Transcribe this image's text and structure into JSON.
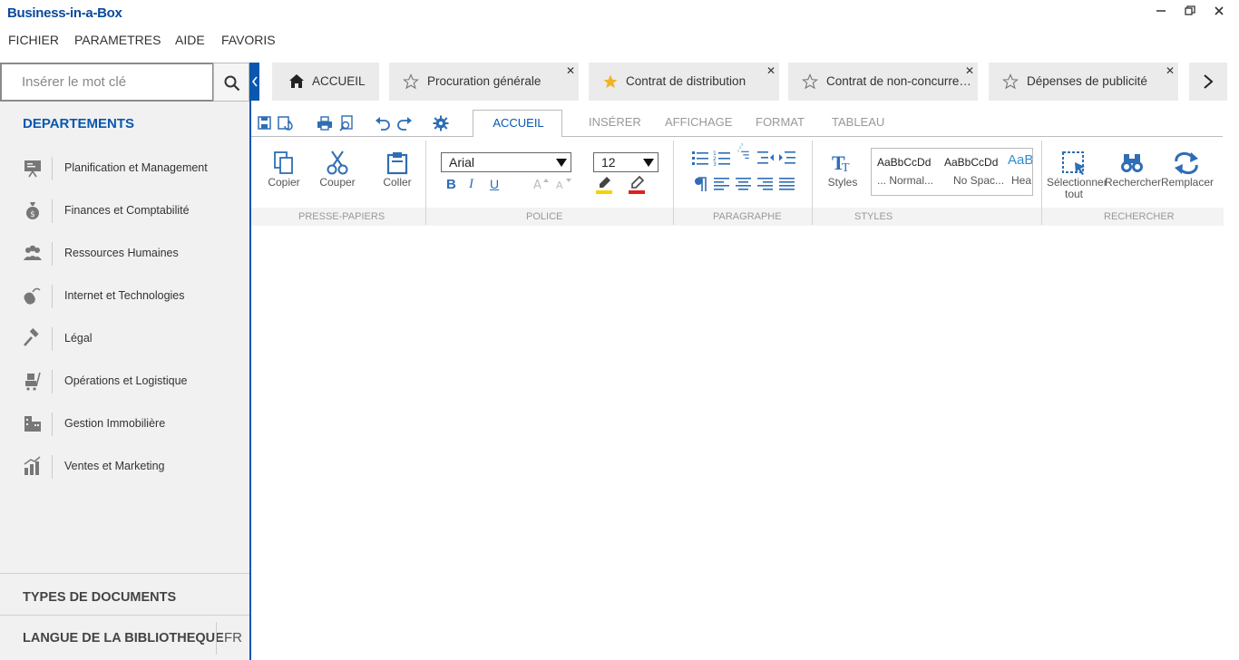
{
  "app": {
    "logo": "Business-in-a-Box",
    "window": {
      "minimize": "—",
      "restore": "❐",
      "close": "✕"
    }
  },
  "menu": [
    "FICHIER",
    "PARAMETRES",
    "AIDE",
    "FAVORIS"
  ],
  "sidebar": {
    "search_placeholder": "Insérer le mot clé",
    "departments_title": "DEPARTEMENTS",
    "departments": [
      {
        "label": "Planification et Management",
        "icon": "presentation-board-icon"
      },
      {
        "label": "Finances et Comptabilité",
        "icon": "money-bag-icon"
      },
      {
        "label": "Ressources Humaines",
        "icon": "people-group-icon"
      },
      {
        "label": "Internet et Technologies",
        "icon": "mouse-icon"
      },
      {
        "label": "Légal",
        "icon": "gavel-icon"
      },
      {
        "label": "Opérations et Logistique",
        "icon": "cart-icon"
      },
      {
        "label": "Gestion Immobilière",
        "icon": "buildings-icon"
      },
      {
        "label": "Ventes et Marketing",
        "icon": "bar-growth-icon"
      }
    ],
    "document_types": "TYPES DE DOCUMENTS",
    "library_language": "LANGUE DE LA BIBLIOTHEQUE",
    "language_code": "FR"
  },
  "tabs": {
    "home": "ACCUEIL",
    "documents": [
      {
        "label": "Procuration générale",
        "favorite": false
      },
      {
        "label": "Contrat de distribution",
        "favorite": true
      },
      {
        "label": "Contrat de non-concurren...",
        "favorite": false
      },
      {
        "label": "Dépenses de publicité",
        "favorite": false
      }
    ]
  },
  "ribbon": {
    "tabs": [
      "ACCUEIL",
      "INSÉRER",
      "AFFICHAGE",
      "FORMAT",
      "TABLEAU"
    ],
    "active_tab": "ACCUEIL",
    "clipboard": {
      "copy": "Copier",
      "cut": "Couper",
      "paste": "Coller",
      "group": "PRESSE-PAPIERS"
    },
    "font": {
      "family": "Arial",
      "size": "12",
      "bold": "B",
      "italic": "I",
      "underline": "U",
      "group": "POLICE"
    },
    "paragraph": {
      "group": "PARAGRAPHE"
    },
    "styles": {
      "button": "Styles",
      "group": "STYLES",
      "gallery": [
        {
          "sample": "AaBbCcDd",
          "name": "... Normal..."
        },
        {
          "sample": "AaBbCcDd",
          "name": "No Spac..."
        },
        {
          "sample": "AaB",
          "name": "Hea"
        }
      ]
    },
    "search": {
      "select_all": "Sélectionner tout",
      "find": "Rechercher",
      "replace": "Remplacer",
      "group": "RECHERCHER"
    }
  },
  "colors": {
    "accent": "#0a57b0",
    "star_active": "#f0b429",
    "highlight": "#f5d200",
    "font_color": "#e02020"
  }
}
